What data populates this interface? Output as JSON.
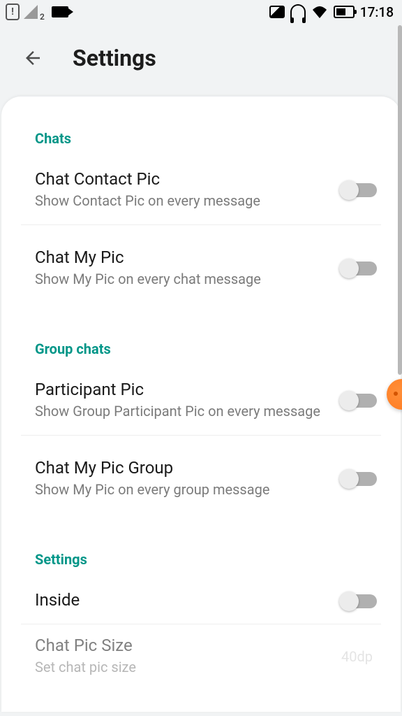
{
  "status_bar": {
    "signal_sub": "2",
    "time": "17:18"
  },
  "header": {
    "title": "Settings"
  },
  "sections": {
    "chats": {
      "header": "Chats",
      "items": [
        {
          "title": "Chat Contact Pic",
          "subtitle": "Show Contact Pic on every message"
        },
        {
          "title": "Chat My Pic",
          "subtitle": "Show My Pic on every chat message"
        }
      ]
    },
    "group_chats": {
      "header": "Group chats",
      "items": [
        {
          "title": "Participant Pic",
          "subtitle": "Show Group Participant Pic on every message"
        },
        {
          "title": "Chat My Pic Group",
          "subtitle": "Show My Pic on every group message"
        }
      ]
    },
    "settings": {
      "header": "Settings",
      "items": [
        {
          "title": "Inside",
          "subtitle": ""
        },
        {
          "title": "Chat Pic Size",
          "subtitle": "Set chat pic size",
          "value": "40dp"
        }
      ]
    }
  }
}
